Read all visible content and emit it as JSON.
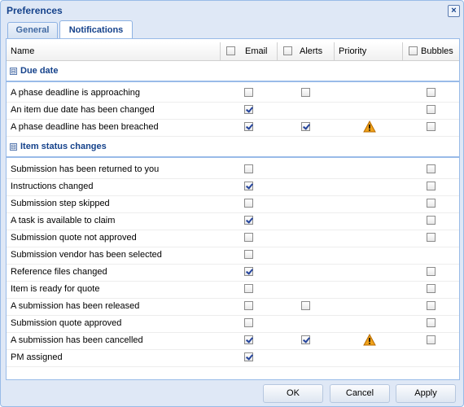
{
  "window": {
    "title": "Preferences",
    "close_icon": "close-icon"
  },
  "tabs": [
    {
      "label": "General"
    },
    {
      "label": "Notifications"
    }
  ],
  "columns": {
    "name": "Name",
    "email": "Email",
    "alerts": "Alerts",
    "priority": "Priority",
    "bubbles": "Bubbles"
  },
  "groups": [
    {
      "title": "Due date",
      "toggle": "⊟"
    },
    {
      "title": "Item status changes",
      "toggle": "⊟"
    }
  ],
  "rows": [
    {
      "name": "A phase deadline is approaching",
      "email": false,
      "alerts": false,
      "priority": false,
      "bubbles": false
    },
    {
      "name": "An item due date has been changed",
      "email": true,
      "alerts": null,
      "priority": false,
      "bubbles": false
    },
    {
      "name": "A phase deadline has been breached",
      "email": true,
      "alerts": true,
      "priority": true,
      "bubbles": false
    },
    {
      "name": "Submission has been returned to you",
      "email": false,
      "alerts": null,
      "priority": false,
      "bubbles": false
    },
    {
      "name": "Instructions changed",
      "email": true,
      "alerts": null,
      "priority": false,
      "bubbles": false
    },
    {
      "name": "Submission step skipped",
      "email": false,
      "alerts": null,
      "priority": false,
      "bubbles": false
    },
    {
      "name": "A task is available to claim",
      "email": true,
      "alerts": null,
      "priority": false,
      "bubbles": false
    },
    {
      "name": "Submission quote not approved",
      "email": false,
      "alerts": null,
      "priority": false,
      "bubbles": false
    },
    {
      "name": "Submission vendor has been selected",
      "email": false,
      "alerts": null,
      "priority": false,
      "bubbles": null
    },
    {
      "name": "Reference files changed",
      "email": true,
      "alerts": null,
      "priority": false,
      "bubbles": false
    },
    {
      "name": "Item is ready for quote",
      "email": false,
      "alerts": null,
      "priority": false,
      "bubbles": false
    },
    {
      "name": "A submission has been released",
      "email": false,
      "alerts": false,
      "priority": false,
      "bubbles": false
    },
    {
      "name": "Submission quote approved",
      "email": false,
      "alerts": null,
      "priority": false,
      "bubbles": false
    },
    {
      "name": "A submission has been cancelled",
      "email": true,
      "alerts": true,
      "priority": true,
      "bubbles": false
    },
    {
      "name": "PM assigned",
      "email": true,
      "alerts": null,
      "priority": false,
      "bubbles": null
    }
  ],
  "buttons": {
    "ok": "OK",
    "cancel": "Cancel",
    "apply": "Apply"
  },
  "colors": {
    "accent": "#15428b",
    "panel_border": "#99bbe8",
    "window_bg": "#dfe8f6",
    "warning": "#f0a21a"
  }
}
